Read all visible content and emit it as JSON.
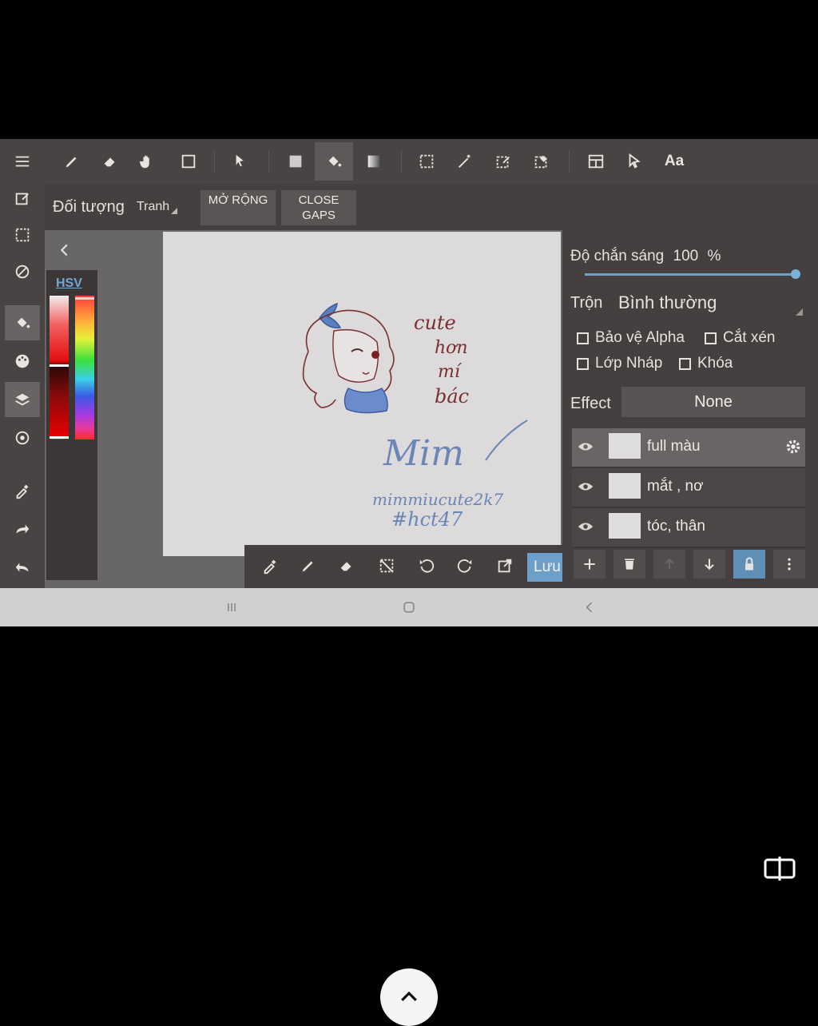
{
  "toolbar": {
    "text_tool_label": "Aa"
  },
  "subbar": {
    "target_label": "Đối tượng",
    "target_value": "Tranh",
    "expand_label": "MỞ RỘNG",
    "close_gaps_label": "CLOSE GAPS"
  },
  "color_panel": {
    "mode_label": "HSV"
  },
  "canvas": {
    "text_lines": [
      "cute",
      "hơn",
      "mí",
      "bác"
    ],
    "signature": "Mim",
    "handle": "mimmiucute2k7",
    "hashtag": "#hct47"
  },
  "layer_panel": {
    "opacity_label": "Độ chắn sáng",
    "opacity_value": "100",
    "opacity_unit": "%",
    "opacity_fraction": 1.0,
    "blend_label": "Trộn",
    "blend_value": "Bình thường",
    "checkboxes": [
      {
        "label": "Bảo vệ Alpha",
        "checked": false
      },
      {
        "label": "Cắt xén",
        "checked": false
      },
      {
        "label": "Lớp Nháp",
        "checked": false
      },
      {
        "label": "Khóa",
        "checked": false
      }
    ],
    "effect_label": "Effect",
    "effect_value": "None",
    "layers": [
      {
        "name": "full màu",
        "selected": true
      },
      {
        "name": "mắt , nơ",
        "selected": false
      },
      {
        "name": "tóc, thân",
        "selected": false
      }
    ]
  },
  "bottom_tools": {
    "save_label": "Lưu"
  },
  "colors": {
    "accent": "#6e9fc8",
    "hsv_label": "#6fa8d0",
    "panel_bg": "#453f3f"
  }
}
